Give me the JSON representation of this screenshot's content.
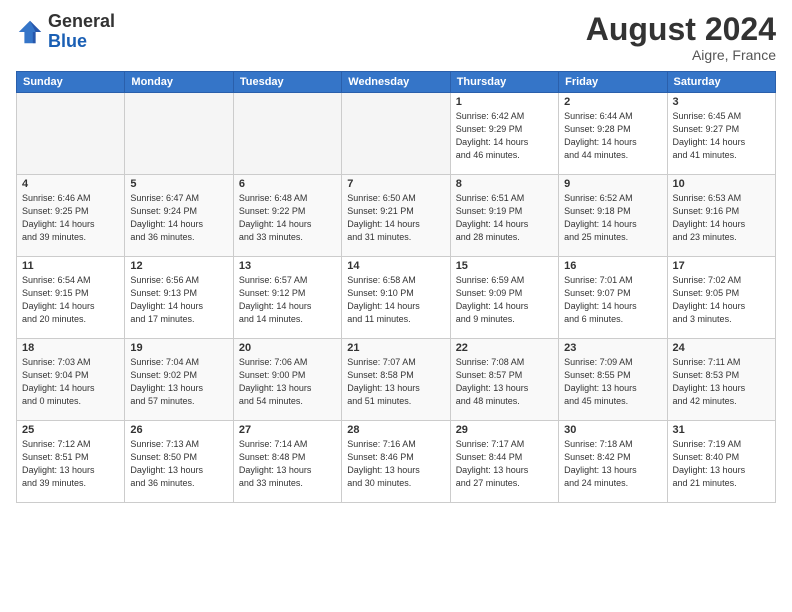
{
  "header": {
    "logo_general": "General",
    "logo_blue": "Blue",
    "month_title": "August 2024",
    "location": "Aigre, France"
  },
  "weekdays": [
    "Sunday",
    "Monday",
    "Tuesday",
    "Wednesday",
    "Thursday",
    "Friday",
    "Saturday"
  ],
  "weeks": [
    [
      {
        "day": "",
        "info": ""
      },
      {
        "day": "",
        "info": ""
      },
      {
        "day": "",
        "info": ""
      },
      {
        "day": "",
        "info": ""
      },
      {
        "day": "1",
        "info": "Sunrise: 6:42 AM\nSunset: 9:29 PM\nDaylight: 14 hours\nand 46 minutes."
      },
      {
        "day": "2",
        "info": "Sunrise: 6:44 AM\nSunset: 9:28 PM\nDaylight: 14 hours\nand 44 minutes."
      },
      {
        "day": "3",
        "info": "Sunrise: 6:45 AM\nSunset: 9:27 PM\nDaylight: 14 hours\nand 41 minutes."
      }
    ],
    [
      {
        "day": "4",
        "info": "Sunrise: 6:46 AM\nSunset: 9:25 PM\nDaylight: 14 hours\nand 39 minutes."
      },
      {
        "day": "5",
        "info": "Sunrise: 6:47 AM\nSunset: 9:24 PM\nDaylight: 14 hours\nand 36 minutes."
      },
      {
        "day": "6",
        "info": "Sunrise: 6:48 AM\nSunset: 9:22 PM\nDaylight: 14 hours\nand 33 minutes."
      },
      {
        "day": "7",
        "info": "Sunrise: 6:50 AM\nSunset: 9:21 PM\nDaylight: 14 hours\nand 31 minutes."
      },
      {
        "day": "8",
        "info": "Sunrise: 6:51 AM\nSunset: 9:19 PM\nDaylight: 14 hours\nand 28 minutes."
      },
      {
        "day": "9",
        "info": "Sunrise: 6:52 AM\nSunset: 9:18 PM\nDaylight: 14 hours\nand 25 minutes."
      },
      {
        "day": "10",
        "info": "Sunrise: 6:53 AM\nSunset: 9:16 PM\nDaylight: 14 hours\nand 23 minutes."
      }
    ],
    [
      {
        "day": "11",
        "info": "Sunrise: 6:54 AM\nSunset: 9:15 PM\nDaylight: 14 hours\nand 20 minutes."
      },
      {
        "day": "12",
        "info": "Sunrise: 6:56 AM\nSunset: 9:13 PM\nDaylight: 14 hours\nand 17 minutes."
      },
      {
        "day": "13",
        "info": "Sunrise: 6:57 AM\nSunset: 9:12 PM\nDaylight: 14 hours\nand 14 minutes."
      },
      {
        "day": "14",
        "info": "Sunrise: 6:58 AM\nSunset: 9:10 PM\nDaylight: 14 hours\nand 11 minutes."
      },
      {
        "day": "15",
        "info": "Sunrise: 6:59 AM\nSunset: 9:09 PM\nDaylight: 14 hours\nand 9 minutes."
      },
      {
        "day": "16",
        "info": "Sunrise: 7:01 AM\nSunset: 9:07 PM\nDaylight: 14 hours\nand 6 minutes."
      },
      {
        "day": "17",
        "info": "Sunrise: 7:02 AM\nSunset: 9:05 PM\nDaylight: 14 hours\nand 3 minutes."
      }
    ],
    [
      {
        "day": "18",
        "info": "Sunrise: 7:03 AM\nSunset: 9:04 PM\nDaylight: 14 hours\nand 0 minutes."
      },
      {
        "day": "19",
        "info": "Sunrise: 7:04 AM\nSunset: 9:02 PM\nDaylight: 13 hours\nand 57 minutes."
      },
      {
        "day": "20",
        "info": "Sunrise: 7:06 AM\nSunset: 9:00 PM\nDaylight: 13 hours\nand 54 minutes."
      },
      {
        "day": "21",
        "info": "Sunrise: 7:07 AM\nSunset: 8:58 PM\nDaylight: 13 hours\nand 51 minutes."
      },
      {
        "day": "22",
        "info": "Sunrise: 7:08 AM\nSunset: 8:57 PM\nDaylight: 13 hours\nand 48 minutes."
      },
      {
        "day": "23",
        "info": "Sunrise: 7:09 AM\nSunset: 8:55 PM\nDaylight: 13 hours\nand 45 minutes."
      },
      {
        "day": "24",
        "info": "Sunrise: 7:11 AM\nSunset: 8:53 PM\nDaylight: 13 hours\nand 42 minutes."
      }
    ],
    [
      {
        "day": "25",
        "info": "Sunrise: 7:12 AM\nSunset: 8:51 PM\nDaylight: 13 hours\nand 39 minutes."
      },
      {
        "day": "26",
        "info": "Sunrise: 7:13 AM\nSunset: 8:50 PM\nDaylight: 13 hours\nand 36 minutes."
      },
      {
        "day": "27",
        "info": "Sunrise: 7:14 AM\nSunset: 8:48 PM\nDaylight: 13 hours\nand 33 minutes."
      },
      {
        "day": "28",
        "info": "Sunrise: 7:16 AM\nSunset: 8:46 PM\nDaylight: 13 hours\nand 30 minutes."
      },
      {
        "day": "29",
        "info": "Sunrise: 7:17 AM\nSunset: 8:44 PM\nDaylight: 13 hours\nand 27 minutes."
      },
      {
        "day": "30",
        "info": "Sunrise: 7:18 AM\nSunset: 8:42 PM\nDaylight: 13 hours\nand 24 minutes."
      },
      {
        "day": "31",
        "info": "Sunrise: 7:19 AM\nSunset: 8:40 PM\nDaylight: 13 hours\nand 21 minutes."
      }
    ]
  ]
}
